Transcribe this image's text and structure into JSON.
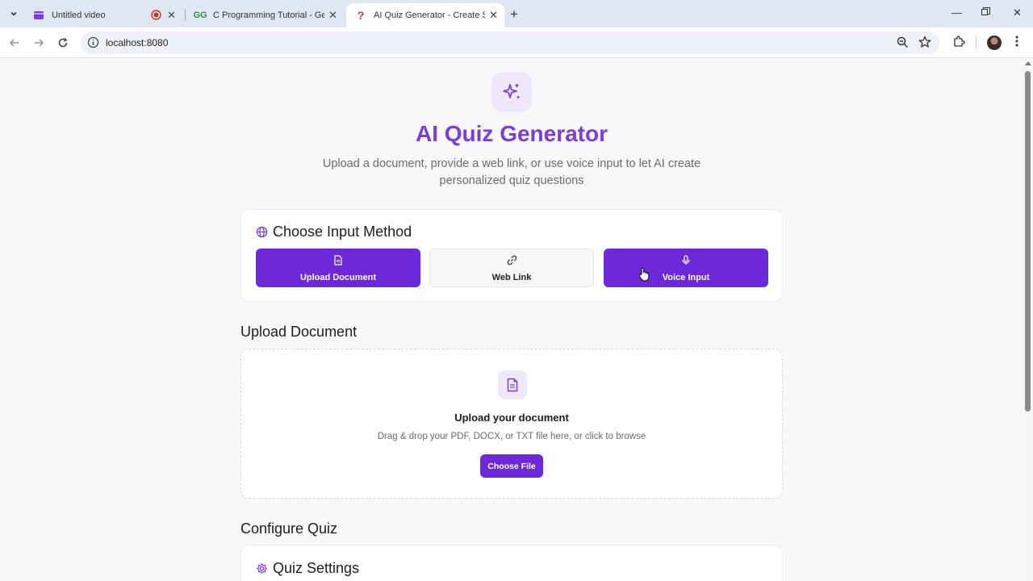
{
  "browser": {
    "tabs": [
      {
        "title": "Untitled video",
        "active": false
      },
      {
        "title": "C Programming Tutorial - Geeks",
        "active": false
      },
      {
        "title": "AI Quiz Generator - Create Sma",
        "active": true
      }
    ],
    "url": "localhost:8080"
  },
  "hero": {
    "title": "AI Quiz Generator",
    "subtitle": "Upload a document, provide a web link, or use voice input to let AI create personalized quiz questions"
  },
  "input_method": {
    "title": "Choose Input Method",
    "options": [
      {
        "label": "Upload Document",
        "icon": "file-text-icon",
        "selected": true
      },
      {
        "label": "Web Link",
        "icon": "link-icon",
        "selected": false
      },
      {
        "label": "Voice Input",
        "icon": "mic-icon",
        "selected": true
      }
    ]
  },
  "upload": {
    "section_title": "Upload Document",
    "title": "Upload your document",
    "subtitle": "Drag & drop your PDF, DOCX, or TXT file here, or click to browse",
    "button": "Choose File"
  },
  "configure": {
    "section_title": "Configure Quiz",
    "settings_title": "Quiz Settings"
  },
  "colors": {
    "accent": "#6d28d9",
    "title": "#7b3fd6",
    "icon_bg": "#efe7fb"
  }
}
